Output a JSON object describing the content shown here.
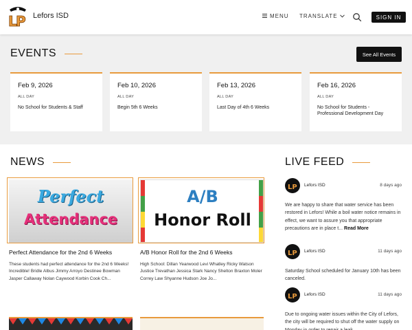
{
  "header": {
    "site_name": "Lefors ISD",
    "menu_label": "MENU",
    "translate_label": "TRANSLATE",
    "signin_label": "SIGN IN",
    "logo_letters": "LP"
  },
  "colors": {
    "accent": "#e89a3c",
    "dark": "#111111",
    "band": "#f0f0f0"
  },
  "events": {
    "title": "EVENTS",
    "see_all_label": "See All Events",
    "items": [
      {
        "date": "Feb 9, 2026",
        "time": "ALL DAY",
        "title": "No School for Students & Staff"
      },
      {
        "date": "Feb 10, 2026",
        "time": "ALL DAY",
        "title": "Begin 5th 6 Weeks"
      },
      {
        "date": "Feb 13, 2026",
        "time": "ALL DAY",
        "title": "Last Day of 4th 6 Weeks"
      },
      {
        "date": "Feb 16, 2026",
        "time": "ALL DAY",
        "title": "No School for Students - Professional Development Day"
      }
    ]
  },
  "news": {
    "title": "NEWS",
    "items": [
      {
        "image_line1": "Perfect",
        "image_line2": "Attendance",
        "title": "Perfect Attendance for the 2nd 6 Weeks",
        "description": "These students had perfect attendance for the 2nd 6 Weeks! Incredible! Bridle Albus Jimmy Arroyo Destinee Bowman Jasper Callaway Nolan Caywood Korbin Cook Ch..."
      },
      {
        "image_line1": "A/B",
        "image_line2": "Honor Roll",
        "title": "A/B Honor Roll for the 2nd 6 Weeks",
        "description": "High School: Dillan Yearwood Levi Whatley Ricky Watson Justice Trevathan Jessica Stark Nancy Shelton Braxton Moler Correy Law Shyanne Hudson Joe Jo..."
      }
    ]
  },
  "feed": {
    "title": "LIVE FEED",
    "items": [
      {
        "name": "Lefors ISD",
        "time": "8 days ago",
        "text": "We are happy to share that water service has been restored in Lefors! While a boil water notice remains in effect, we want to assure you that appropriate precautions are in place t...",
        "more": "Read More"
      },
      {
        "name": "Lefors ISD",
        "time": "11 days ago",
        "text": "Saturday School scheduled for January 10th has been canceled.",
        "more": ""
      },
      {
        "name": "Lefors ISD",
        "time": "11 days ago",
        "text": "Due to ongoing water issues within the City of Lefors, the city will be required to shut off the water supply on Monday in order to repair a leak.",
        "more": ""
      }
    ]
  },
  "icons": {
    "menu": "hamburger-icon",
    "translate": "chevron-down-icon",
    "search": "search-icon"
  }
}
